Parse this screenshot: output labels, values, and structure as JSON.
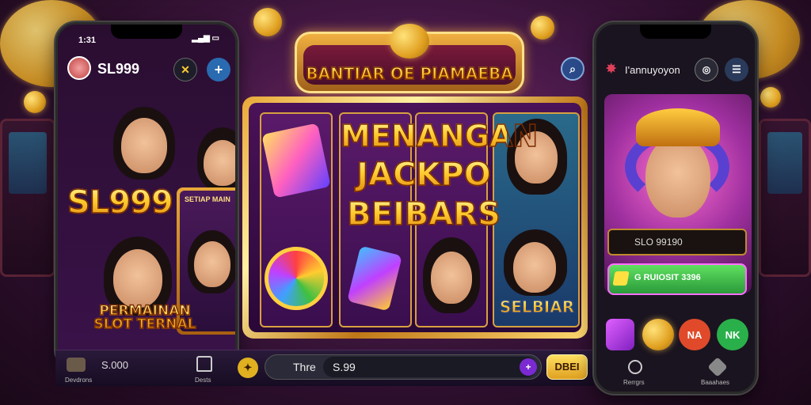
{
  "left_phone": {
    "time": "1:31",
    "username": "SL999",
    "logo_text": "SL999",
    "promo_text": "PERMAINAN SLOT TERNAL",
    "card_label": "SETIAP MAIN"
  },
  "center": {
    "banner_title": "BANTIAR OE PIAMAEBA",
    "headline_line1": "MENANGAN",
    "headline_line2": "JACKPO",
    "headline_line3": "BEIBARS",
    "badge_text": "SELBIAR"
  },
  "bottom_bar": {
    "nav_left_label": "Devdrons",
    "balance": "S.000",
    "nav_center_label": "Dests",
    "bet_prefix": "Thre",
    "bet_value": "S.99",
    "spin_button": "DBEI"
  },
  "right_phone": {
    "title": "I'annuyoyon",
    "field_value": "SLO 99190",
    "cta_label": "G RUIOSIT 3396",
    "tab1_label": "NA",
    "tab2_label": "NK",
    "nav_left_label": "Rerrgrs",
    "nav_right_label": "Baaahaes"
  },
  "colors": {
    "accent_gold": "#ffcc30",
    "accent_green": "#3ab04a",
    "accent_purple": "#7a2aa0",
    "accent_red": "#e04a2a"
  },
  "icons": [
    "search-icon",
    "wallet-icon",
    "home-icon",
    "plus-icon",
    "game-icon",
    "menu-icon",
    "store-icon"
  ]
}
